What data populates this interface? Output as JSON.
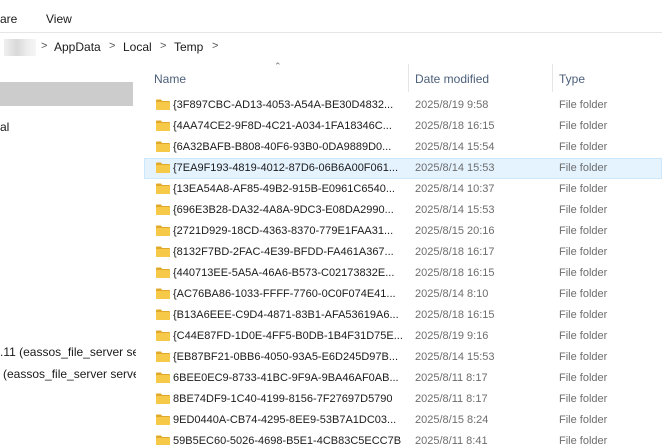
{
  "ribbon": {
    "tabs": [
      "are",
      "View"
    ]
  },
  "address": {
    "crumbs": [
      "AppData",
      "Local",
      "Temp"
    ],
    "separator": ">"
  },
  "nav": {
    "items": [
      {
        "label": ""
      },
      {
        "label": "al"
      },
      {
        "label": ".11 (eassos_file_server serv"
      },
      {
        "label": "(eassos_file_server server"
      }
    ]
  },
  "columns": {
    "name": "Name",
    "date": "Date modified",
    "type": "Type"
  },
  "files": [
    {
      "name": "{3F897CBC-AD13-4053-A54A-BE30D4832...",
      "date": "2025/8/19 9:58",
      "type": "File folder"
    },
    {
      "name": "{4AA74CE2-9F8D-4C21-A034-1FA18346C...",
      "date": "2025/8/18 16:15",
      "type": "File folder"
    },
    {
      "name": "{6A32BAFB-B808-40F6-93B0-0DA9889D0...",
      "date": "2025/8/14 15:54",
      "type": "File folder"
    },
    {
      "name": "{7EA9F193-4819-4012-87D6-06B6A00F061...",
      "date": "2025/8/14 15:53",
      "type": "File folder"
    },
    {
      "name": "{13EA54A8-AF85-49B2-915B-E0961C6540...",
      "date": "2025/8/14 10:37",
      "type": "File folder"
    },
    {
      "name": "{696E3B28-DA32-4A8A-9DC3-E08DA2990...",
      "date": "2025/8/14 15:53",
      "type": "File folder"
    },
    {
      "name": "{2721D929-18CD-4363-8370-779E1FAA31...",
      "date": "2025/8/15 20:16",
      "type": "File folder"
    },
    {
      "name": "{8132F7BD-2FAC-4E39-BFDD-FA461A367...",
      "date": "2025/8/18 16:17",
      "type": "File folder"
    },
    {
      "name": "{440713EE-5A5A-46A6-B573-C02173832E...",
      "date": "2025/8/18 16:15",
      "type": "File folder"
    },
    {
      "name": "{AC76BA86-1033-FFFF-7760-0C0F074E41...",
      "date": "2025/8/14 8:10",
      "type": "File folder"
    },
    {
      "name": "{B13A6EEE-C9D4-4871-83B1-AFA53619A6...",
      "date": "2025/8/18 16:15",
      "type": "File folder"
    },
    {
      "name": "{C44E87FD-1D0E-4FF5-B0DB-1B4F31D75E...",
      "date": "2025/8/19 9:16",
      "type": "File folder"
    },
    {
      "name": "{EB87BF21-0BB6-4050-93A5-E6D245D97B...",
      "date": "2025/8/14 15:53",
      "type": "File folder"
    },
    {
      "name": "6BEE0EC9-8733-41BC-9F9A-9BA46AF0AB...",
      "date": "2025/8/11 8:17",
      "type": "File folder"
    },
    {
      "name": "8BE74DF9-1C40-4199-8156-7F27697D5790",
      "date": "2025/8/11 8:17",
      "type": "File folder"
    },
    {
      "name": "9ED0440A-CB74-4295-8EE9-53B7A1DC03...",
      "date": "2025/8/15 8:24",
      "type": "File folder"
    },
    {
      "name": "59B5EC60-5026-4698-B5E1-4CB83C5ECC7B",
      "date": "2025/8/11 8:41",
      "type": "File folder"
    }
  ],
  "hover_row": 3,
  "colors": {
    "folder": "#f7c948",
    "folder_dark": "#e0a92b",
    "hover": "#e5f3ff",
    "nav_selected": "#cccccc",
    "header_text": "#4c607a"
  },
  "icons": {
    "folder": "folder-icon",
    "sort": "sort-up-icon",
    "chevron": "chevron-right-icon"
  }
}
